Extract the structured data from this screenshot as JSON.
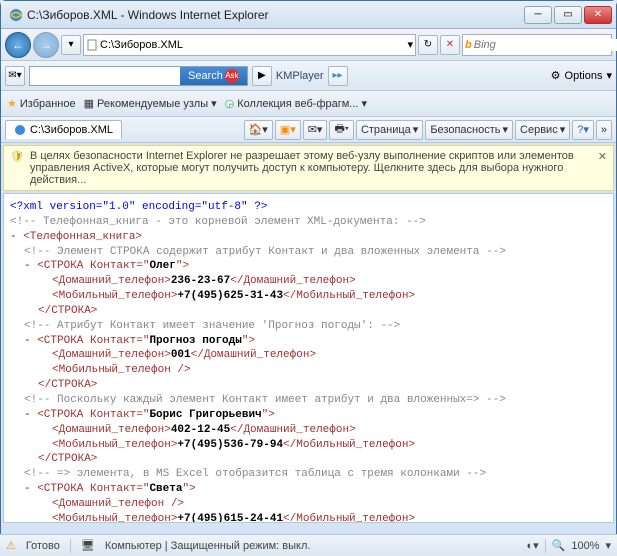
{
  "window": {
    "title": "C:\\Зиборов.XML - Windows Internet Explorer"
  },
  "nav": {
    "address": "C:\\Зиборов.XML",
    "search_placeholder": "Bing"
  },
  "toolbar2": {
    "search_label": "Search",
    "kmplayer": "KMPlayer",
    "options": "Options"
  },
  "favorites": {
    "label": "Избранное",
    "recommended": "Рекомендуемые узлы",
    "collection": "Коллекция веб-фрагм..."
  },
  "tab": {
    "label": "C:\\Зиборов.XML"
  },
  "cmdbar": {
    "page": "Страница",
    "safety": "Безопасность",
    "service": "Сервис"
  },
  "infobar": {
    "text": "В целях безопасности Internet Explorer не разрешает этому веб-узлу выполнение скриптов или элементов управления ActiveX, которые могут получить доступ к компьютеру. Щелкните здесь для выбора нужного действия..."
  },
  "xml": {
    "decl": "<?xml version=\"1.0\" encoding=\"utf-8\" ?>",
    "c1": "<!-- Телефонная_книга - это корневой элемент XML-документа: -->",
    "root_open": "Телефонная_книга",
    "c2": "<!-- Элемент СТРОКА содержит атрибут Контакт и два вложенных элемента -->",
    "rows": [
      {
        "attr": "Олег",
        "home": "236-23-67",
        "mobile": "+7(495)625-31-43"
      },
      {
        "attr": "Прогноз погоды",
        "home": "001",
        "mobile": ""
      },
      {
        "attr": "Борис Григорьевич",
        "home": "402-12-45",
        "mobile": "+7(495)536-79-94"
      },
      {
        "attr": "Света",
        "home": "",
        "mobile": "+7(495)615-24-41"
      }
    ],
    "c3": "<!-- Атрибут Контакт имеет значение 'Прогноз погоды': -->",
    "c4": "<!-- Поскольку каждый элемент Контакт имеет атрибут и два вложенных=> -->",
    "c5": "<!-- => элемента, в MS Excel отобразится таблица с тремя колонками -->",
    "tag_row": "СТРОКА",
    "tag_attr": "Контакт",
    "tag_home": "Домашний_телефон",
    "tag_mobile": "Мобильный_телефон"
  },
  "status": {
    "ready": "Готово",
    "computer": "Компьютер | Защищенный режим: выкл.",
    "zoom": "100%"
  }
}
